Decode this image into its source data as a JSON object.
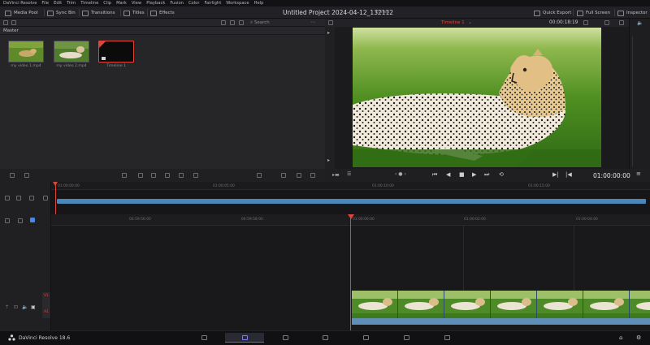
{
  "menu": [
    "DaVinci Resolve",
    "File",
    "Edit",
    "Trim",
    "Timeline",
    "Clip",
    "Mark",
    "View",
    "Playback",
    "Fusion",
    "Color",
    "Fairlight",
    "Workspace",
    "Help"
  ],
  "toolbar": {
    "media_pool": "Media Pool",
    "sync_bin": "Sync Bin",
    "transitions": "Transitions",
    "titles": "Titles",
    "effects": "Effects",
    "quick_export": "Quick Export",
    "full_screen": "Full Screen",
    "inspector": "Inspector"
  },
  "project": {
    "title": "Untitled Project 2024-04-12_132112",
    "status": "Edited"
  },
  "media_pool": {
    "search_label": "Search",
    "bin_label": "Master",
    "clips": [
      {
        "label": "my video 1.mp4",
        "type": "video"
      },
      {
        "label": "my video 2.mp4",
        "type": "video"
      },
      {
        "label": "Timeline 1",
        "type": "timeline"
      }
    ]
  },
  "viewer": {
    "timeline_name": "Timeline 1",
    "source_timecode": "00:00:18:19",
    "current_timecode": "01:00:00:00"
  },
  "upper_timeline": {
    "ruler": [
      "01:00:00:00",
      "01:00:05:00",
      "01:00:10:00",
      "01:00:15:00"
    ]
  },
  "lower_timeline": {
    "ruler": [
      "00:59:56:00",
      "00:59:58:00",
      "01:00:00:00",
      "01:00:02:00",
      "01:00:04:00"
    ]
  },
  "tracks": {
    "video": "V1",
    "audio": "A1"
  },
  "status": {
    "app_name": "DaVinci Resolve 18.6"
  },
  "colors": {
    "accent": "#e0453a",
    "clip_blue": "#4a86b8",
    "bg": "#1c1c1f"
  }
}
